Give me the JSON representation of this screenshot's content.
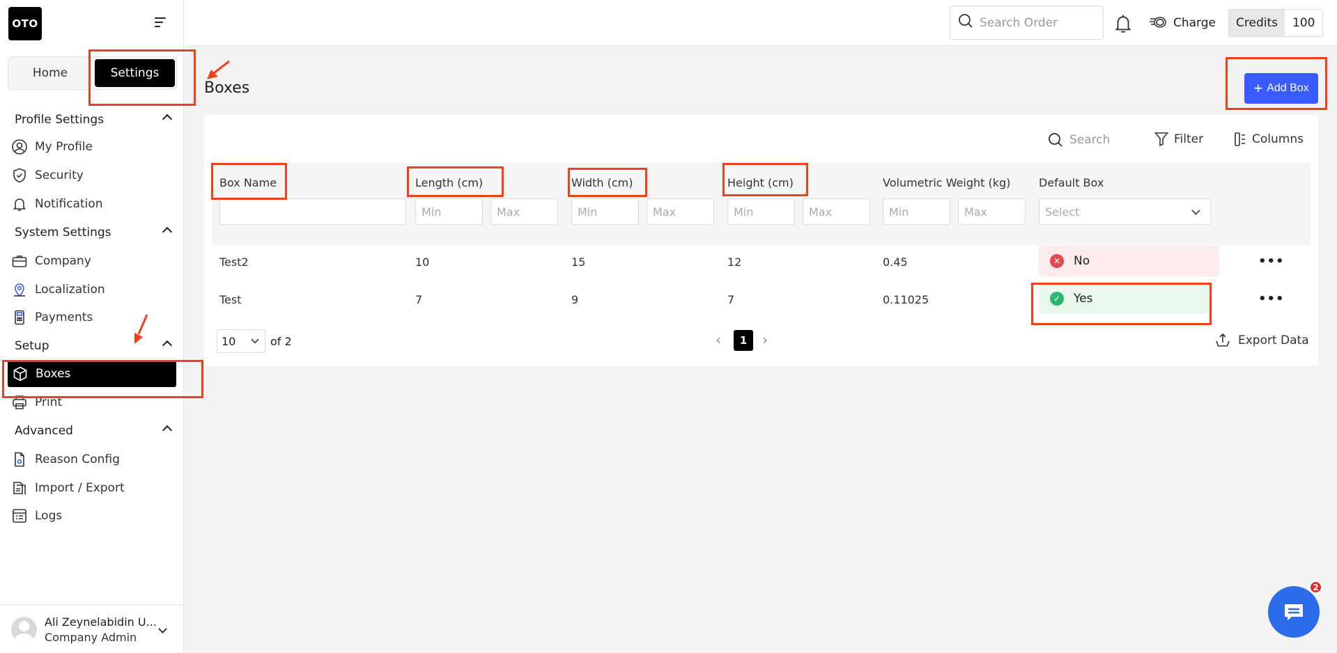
{
  "app": {
    "logo_text": "OTO"
  },
  "sidebar": {
    "segments": {
      "home": "Home",
      "settings": "Settings"
    },
    "groups": [
      {
        "title": "Profile Settings",
        "items": [
          "My Profile",
          "Security",
          "Notification"
        ]
      },
      {
        "title": "System Settings",
        "items": [
          "Company",
          "Localization",
          "Payments"
        ]
      },
      {
        "title": "Setup",
        "items": [
          "Boxes",
          "Print"
        ]
      },
      {
        "title": "Advanced",
        "items": [
          "Reason Config",
          "Import / Export",
          "Logs"
        ]
      }
    ],
    "active_item": "Boxes"
  },
  "user": {
    "name": "Ali Zeynelabidin U...",
    "role": "Company Admin"
  },
  "topbar": {
    "search_placeholder": "Search Order",
    "charge_label": "Charge",
    "credits_label": "Credits",
    "credits_value": "100"
  },
  "main": {
    "title": "Boxes",
    "add_button": "Add Box",
    "toolbar": {
      "search": "Search",
      "filter": "Filter",
      "columns": "Columns"
    },
    "columns": [
      "Box Name",
      "Length (cm)",
      "Width (cm)",
      "Height (cm)",
      "Volumetric Weight (kg)",
      "Default Box"
    ],
    "filters": {
      "min": "Min",
      "max": "Max",
      "select": "Select"
    },
    "rows": [
      {
        "name": "Test2",
        "length": "10",
        "width": "15",
        "height": "12",
        "vol_weight": "0.45",
        "default": "No"
      },
      {
        "name": "Test",
        "length": "7",
        "width": "9",
        "height": "7",
        "vol_weight": "0.11025",
        "default": "Yes"
      }
    ],
    "pagination": {
      "per_page": "10",
      "of_total": "of 2",
      "current_page": "1"
    },
    "export_label": "Export Data"
  },
  "chat": {
    "badge": "2"
  },
  "colors": {
    "primary": "#3a5bff",
    "annotation": "#f0401a",
    "no": "#e5484d",
    "yes": "#2bb673"
  }
}
